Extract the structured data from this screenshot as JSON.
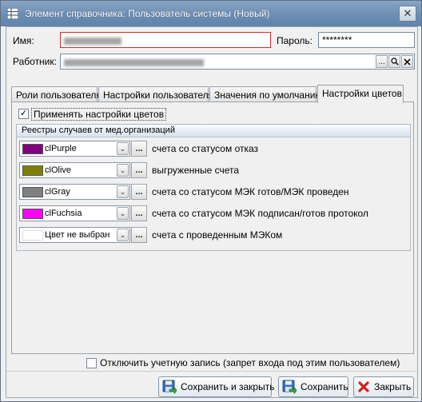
{
  "window": {
    "title": "Элемент справочника: Пользователь системы (Новый)",
    "close_glyph": "✕"
  },
  "form": {
    "name_label": "Имя:",
    "password_label": "Пароль:",
    "password_value": "********",
    "worker_label": "Работник:",
    "worker_ellipsis": "...",
    "worker_search_icon": "search-icon",
    "worker_clear_icon": "clear-icon"
  },
  "tabs": [
    {
      "label": "Роли пользователя",
      "active": false
    },
    {
      "label": "Настройки пользователя",
      "active": false
    },
    {
      "label": "Значения по умолчанию",
      "active": false
    },
    {
      "label": "Настройки цветов",
      "active": true
    }
  ],
  "color_settings": {
    "apply_label": "Применять настройки цветов",
    "apply_checked": true,
    "group_title": "Реестры случаев от мед.организаций",
    "ellipsis": "...",
    "rows": [
      {
        "color_name": "clPurple",
        "swatch": "#800080",
        "description": "счета со статусом отказ"
      },
      {
        "color_name": "clOlive",
        "swatch": "#808000",
        "description": "выгруженные счета"
      },
      {
        "color_name": "clGray",
        "swatch": "#808080",
        "description": "счета со статусом МЭК готов/МЭК проведен"
      },
      {
        "color_name": "clFuchsia",
        "swatch": "#ff00ff",
        "description": "счета со статусом МЭК подписан/готов протокол"
      },
      {
        "color_name": "Цвет не выбран",
        "swatch": "#ffffff",
        "description": "счета с проведенным МЭКом"
      }
    ]
  },
  "disable_account": {
    "label": "Отключить учетную запись (запрет входа под этим пользователем)",
    "checked": false
  },
  "buttons": {
    "save_close": "Сохранить и закрыть",
    "save": "Сохранить",
    "close": "Закрыть"
  },
  "colors": {
    "title_bar": "#6e8fb4",
    "accent": "#5f83ab",
    "error_border": "#d23030"
  }
}
